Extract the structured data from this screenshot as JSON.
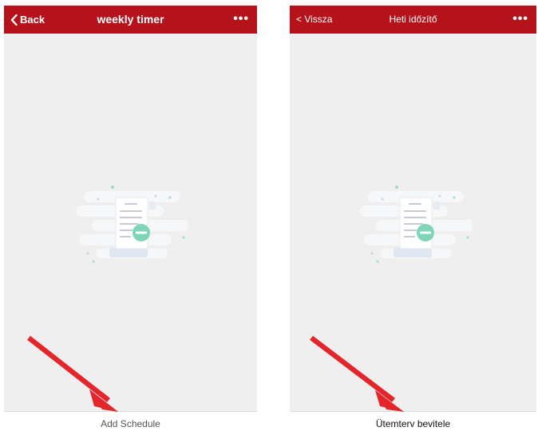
{
  "screens": [
    {
      "back_label": "Back",
      "title": "weekly timer",
      "more_icon": "more-icon",
      "empty_state_icon": "empty-schedule-illustration",
      "bottom_button": "Add Schedule"
    },
    {
      "back_label": "< Vissza",
      "title": "Heti időzítő",
      "more_icon": "more-icon",
      "empty_state_icon": "empty-schedule-illustration",
      "bottom_button": "Ütemterv bevitele"
    }
  ],
  "annotation": {
    "arrow_color": "#e3262b",
    "icon": "red-arrow"
  },
  "colors": {
    "navbar": "#b5121b",
    "background": "#efefef",
    "accent_green": "#7ed6b6"
  }
}
